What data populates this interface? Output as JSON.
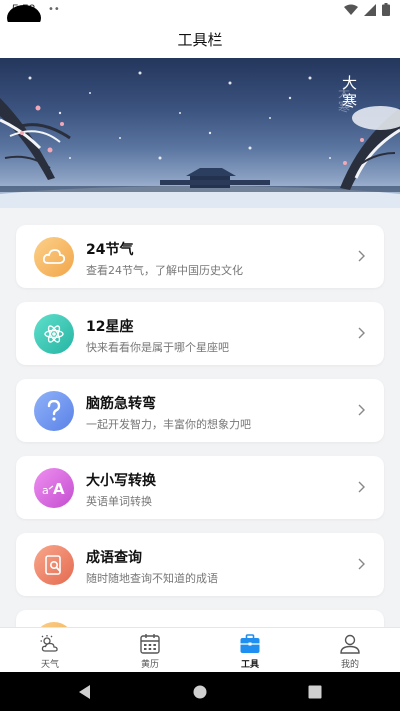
{
  "status": {
    "time": "5:52",
    "notif": "••"
  },
  "header": {
    "title": "工具栏"
  },
  "banner": {
    "text": "大寒",
    "shadow_text": "大寒"
  },
  "tools": [
    {
      "title": "24节气",
      "subtitle": "查看24节气，了解中国历史文化",
      "icon": "cloud-icon",
      "color": "#f5b45c"
    },
    {
      "title": "12星座",
      "subtitle": "快来看看你是属于哪个星座吧",
      "icon": "atom-icon",
      "color": "#36c8b4"
    },
    {
      "title": "脑筋急转弯",
      "subtitle": "一起开发智力，丰富你的想象力吧",
      "icon": "question-icon",
      "color": "#6f95f0"
    },
    {
      "title": "大小写转换",
      "subtitle": "英语单词转换",
      "icon": "letter-case-icon",
      "color": "#d66ad8"
    },
    {
      "title": "成语查询",
      "subtitle": "随时随地查询不知道的成语",
      "icon": "search-book-icon",
      "color": "#f2856a"
    },
    {
      "title": "",
      "subtitle": "",
      "icon": "partial-icon",
      "color": "#f5b45c"
    }
  ],
  "tabs": [
    {
      "label": "天气",
      "icon": "weather-icon",
      "active": false
    },
    {
      "label": "黄历",
      "icon": "calendar-icon",
      "active": false
    },
    {
      "label": "工具",
      "icon": "toolbox-icon",
      "active": true
    },
    {
      "label": "我的",
      "icon": "profile-icon",
      "active": false
    }
  ],
  "colors": {
    "accent": "#1e8ff0",
    "background": "#f2f3f5"
  }
}
